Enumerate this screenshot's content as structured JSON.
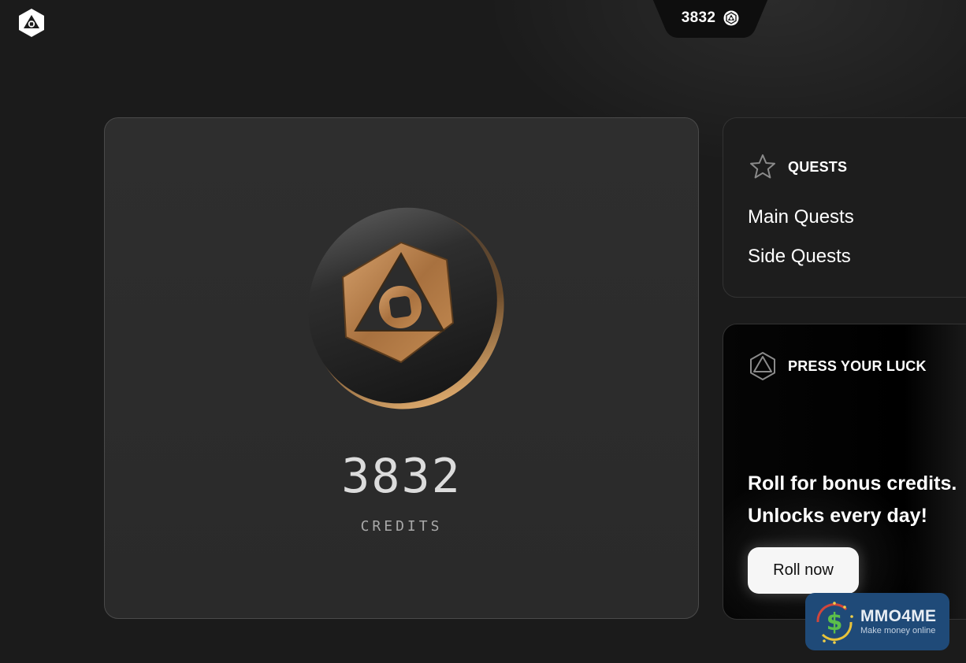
{
  "header": {
    "logo_icon": "hexagon-triangle-logo-icon",
    "balance": "3832",
    "balance_icon": "coin-logo-icon"
  },
  "credits_card": {
    "coin_icon": "bronze-coin-icon",
    "value": "3832",
    "label": "CREDITS"
  },
  "quests": {
    "icon": "star-icon",
    "title": "QUESTS",
    "items": [
      {
        "label": "Main Quests"
      },
      {
        "label": "Side Quests"
      }
    ]
  },
  "press_your_luck": {
    "icon": "octahedron-icon",
    "title": "PRESS YOUR LUCK",
    "line1": "Roll for bonus credits.",
    "line2": "Unlocks every day!",
    "button_label": "Roll now"
  },
  "watermark": {
    "title": "MMO4ME",
    "subtitle": "Make money online"
  },
  "colors": {
    "background": "#1b1b1b",
    "card": "#2c2c2c",
    "bronze": "#b9834d",
    "button": "#f6f6f6"
  }
}
